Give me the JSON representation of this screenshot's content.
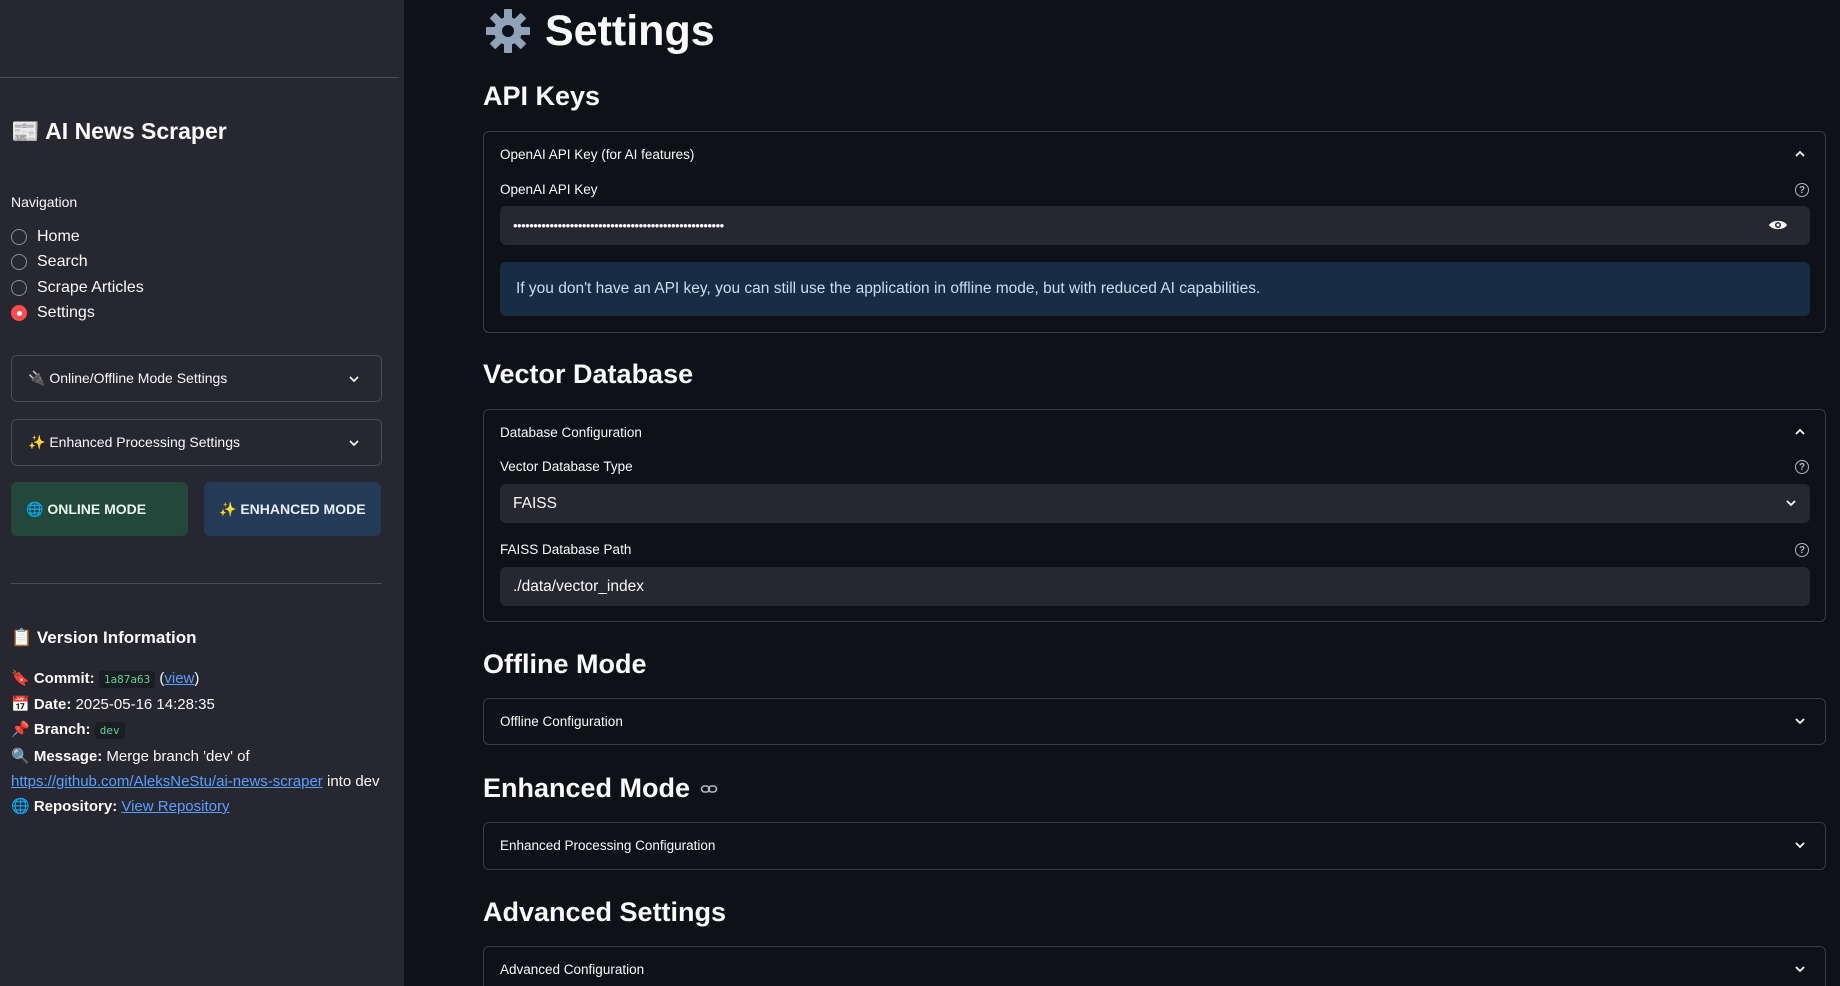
{
  "sidebar": {
    "app_title": "📰 AI News Scraper",
    "nav_label": "Navigation",
    "nav_items": [
      {
        "label": "Home",
        "selected": false
      },
      {
        "label": "Search",
        "selected": false
      },
      {
        "label": "Scrape Articles",
        "selected": false
      },
      {
        "label": "Settings",
        "selected": true
      }
    ],
    "expanders": [
      {
        "label": "🔌 Online/Offline Mode Settings"
      },
      {
        "label": "✨ Enhanced Processing Settings"
      }
    ],
    "online_button": "🌐 ONLINE MODE",
    "enhanced_button": "✨ ENHANCED MODE",
    "version": {
      "title": "📋 Version Information",
      "commit_label": "🔖 Commit:",
      "commit_hash": "1a87a63",
      "commit_link": "view",
      "date_label": "📅 Date:",
      "date_value": "2025-05-16 14:28:35",
      "branch_label": "📌 Branch:",
      "branch_value": "dev",
      "message_label": "🔍 Message:",
      "message_text": "Merge branch 'dev' of",
      "message_link": "https://github.com/AleksNeStu/ai-news-scraper",
      "message_tail": "into dev",
      "repo_label": "🌐 Repository:",
      "repo_link": "View Repository"
    }
  },
  "main": {
    "title": "Settings",
    "sections": {
      "api_keys": "API Keys",
      "vector_db": "Vector Database",
      "offline": "Offline Mode",
      "enhanced": "Enhanced Mode",
      "advanced": "Advanced Settings"
    },
    "api_panel": {
      "header": "OpenAI API Key (for AI features)",
      "field_label": "OpenAI API Key",
      "masked_value": "••••••••••••••••••••••••••••••••••••••••••••••••••••",
      "info": "If you don't have an API key, you can still use the application in offline mode, but with reduced AI capabilities."
    },
    "db_panel": {
      "header": "Database Configuration",
      "type_label": "Vector Database Type",
      "type_value": "FAISS",
      "path_label": "FAISS Database Path",
      "path_value": "./data/vector_index"
    },
    "offline_panel": {
      "header": "Offline Configuration"
    },
    "enhanced_panel": {
      "header": "Enhanced Processing Configuration"
    },
    "advanced_panel": {
      "header": "Advanced Configuration"
    }
  },
  "icons": [
    "gear-icon",
    "chevron-down-icon",
    "chevron-up-icon",
    "eye-icon",
    "help-icon",
    "link-icon"
  ]
}
